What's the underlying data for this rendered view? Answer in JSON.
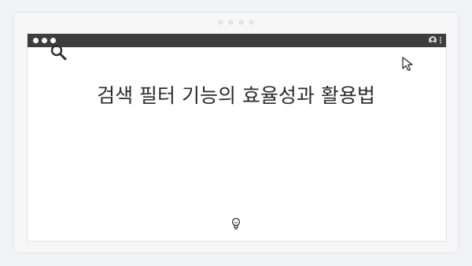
{
  "page": {
    "headline": "검색 필터 기능의 효율성과 활용법"
  },
  "icons": {
    "search": "search-icon",
    "cursor": "cursor-arrow-icon",
    "bulb": "lightbulb-icon",
    "user": "user-account-icon",
    "menu": "kebab-menu-icon"
  },
  "colors": {
    "titlebar": "#3d3d3d",
    "background": "#f2f3f5",
    "text": "#2b2b2b"
  }
}
